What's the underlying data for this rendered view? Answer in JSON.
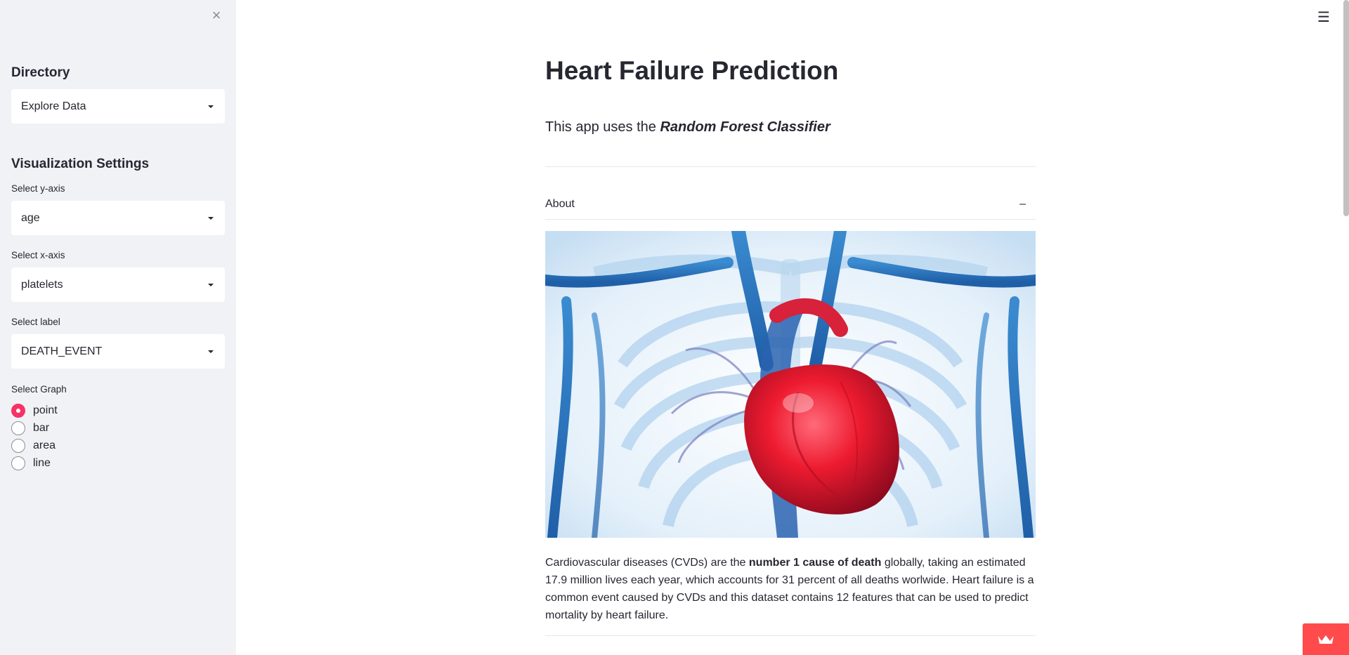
{
  "sidebar": {
    "close_icon": "close-icon",
    "directory_heading": "Directory",
    "directory_select": "Explore Data",
    "viz_heading": "Visualization Settings",
    "y_axis_label": "Select y-axis",
    "y_axis_value": "age",
    "x_axis_label": "Select x-axis",
    "x_axis_value": "platelets",
    "label_label": "Select label",
    "label_value": "DEATH_EVENT",
    "graph_label": "Select Graph",
    "graph_options": [
      "point",
      "bar",
      "area",
      "line"
    ],
    "graph_selected": "point"
  },
  "header": {
    "menu_icon": "hamburger-menu-icon"
  },
  "main": {
    "title": "Heart Failure Prediction",
    "subtitle_prefix": "This app uses the ",
    "subtitle_emphasis": "Random Forest Classifier",
    "expander": {
      "label": "About",
      "toggle": "–"
    },
    "description": {
      "line1_a": "Cardiovascular diseases (CVDs) are the ",
      "line1_bold": "number 1 cause of death",
      "line1_b": " globally, taking an estimated",
      "line2": "17.9 million lives each year, which accounts for 31 percent of all deaths worlwide. Heart failure is a",
      "line3": "common event caused by CVDs and this dataset contains 12 features that can be used to predict",
      "line4": "mortality by heart failure."
    }
  },
  "colors": {
    "accent": "#f63366",
    "sidebar_bg": "#f0f2f6",
    "deploy_badge": "#ff4b4b"
  }
}
